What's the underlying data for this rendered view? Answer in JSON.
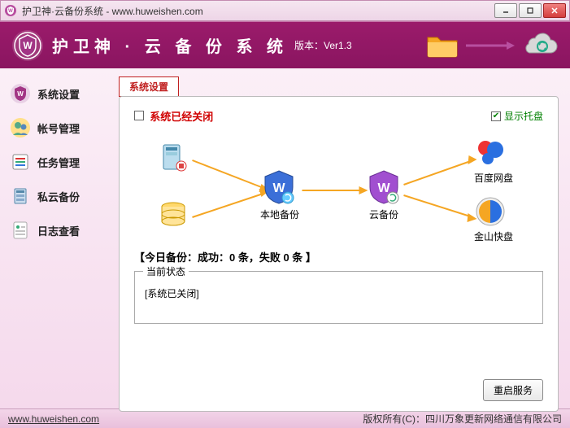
{
  "window": {
    "title": "护卫神·云备份系统 - www.huweishen.com"
  },
  "banner": {
    "title": "护卫神 · 云 备 份 系 统",
    "version": "版本：Ver1.3"
  },
  "sidebar": {
    "items": [
      {
        "label": "系统设置"
      },
      {
        "label": "帐号管理"
      },
      {
        "label": "任务管理"
      },
      {
        "label": "私云备份"
      },
      {
        "label": "日志查看"
      }
    ]
  },
  "content": {
    "tab_label": "系统设置",
    "system_status": "系统已经关闭",
    "show_tray": "显示托盘",
    "diagram": {
      "local_backup": "本地备份",
      "cloud_backup": "云备份",
      "baidu": "百度网盘",
      "jinshan": "金山快盘"
    },
    "today_summary": "【今日备份：成功：0 条，失败 0 条 】",
    "status_box_label": "当前状态",
    "status_text": "[系统已关闭]",
    "restart_btn": "重启服务"
  },
  "footer": {
    "url": "www.huweishen.com",
    "copyright": "版权所有(C)：四川万象更新网络通信有限公司"
  }
}
